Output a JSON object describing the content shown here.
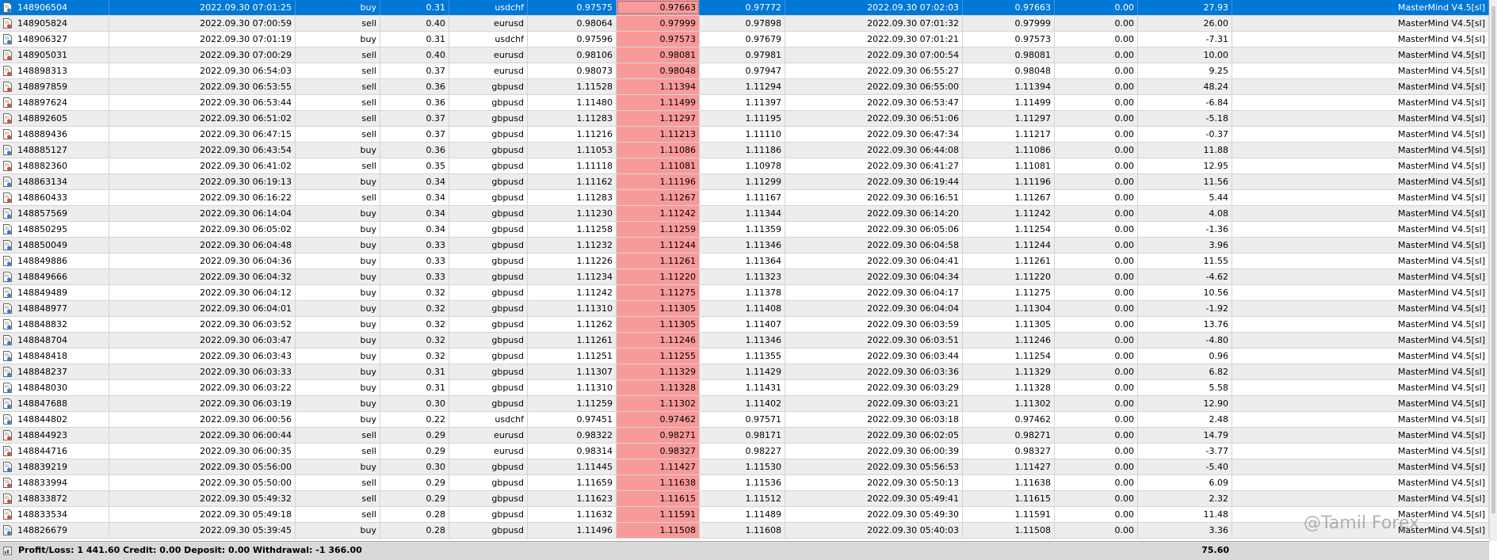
{
  "rows": [
    [
      "148906504",
      "2022.09.30 07:01:25",
      "buy",
      "0.31",
      "usdchf",
      "0.97575",
      "0.97663",
      "0.97772",
      "2022.09.30 07:02:03",
      "0.97663",
      "0.00",
      "27.93",
      "MasterMind V4.5[sl]"
    ],
    [
      "148905824",
      "2022.09.30 07:00:59",
      "sell",
      "0.40",
      "eurusd",
      "0.98064",
      "0.97999",
      "0.97898",
      "2022.09.30 07:01:32",
      "0.97999",
      "0.00",
      "26.00",
      "MasterMind V4.5[sl]"
    ],
    [
      "148906327",
      "2022.09.30 07:01:19",
      "buy",
      "0.31",
      "usdchf",
      "0.97596",
      "0.97573",
      "0.97679",
      "2022.09.30 07:01:21",
      "0.97573",
      "0.00",
      "-7.31",
      "MasterMind V4.5[sl]"
    ],
    [
      "148905031",
      "2022.09.30 07:00:29",
      "sell",
      "0.40",
      "eurusd",
      "0.98106",
      "0.98081",
      "0.97981",
      "2022.09.30 07:00:54",
      "0.98081",
      "0.00",
      "10.00",
      "MasterMind V4.5[sl]"
    ],
    [
      "148898313",
      "2022.09.30 06:54:03",
      "sell",
      "0.37",
      "eurusd",
      "0.98073",
      "0.98048",
      "0.97947",
      "2022.09.30 06:55:27",
      "0.98048",
      "0.00",
      "9.25",
      "MasterMind V4.5[sl]"
    ],
    [
      "148897859",
      "2022.09.30 06:53:55",
      "sell",
      "0.36",
      "gbpusd",
      "1.11528",
      "1.11394",
      "1.11294",
      "2022.09.30 06:55:00",
      "1.11394",
      "0.00",
      "48.24",
      "MasterMind V4.5[sl]"
    ],
    [
      "148897624",
      "2022.09.30 06:53:44",
      "sell",
      "0.36",
      "gbpusd",
      "1.11480",
      "1.11499",
      "1.11397",
      "2022.09.30 06:53:47",
      "1.11499",
      "0.00",
      "-6.84",
      "MasterMind V4.5[sl]"
    ],
    [
      "148892605",
      "2022.09.30 06:51:02",
      "sell",
      "0.37",
      "gbpusd",
      "1.11283",
      "1.11297",
      "1.11195",
      "2022.09.30 06:51:06",
      "1.11297",
      "0.00",
      "-5.18",
      "MasterMind V4.5[sl]"
    ],
    [
      "148889436",
      "2022.09.30 06:47:15",
      "sell",
      "0.37",
      "gbpusd",
      "1.11216",
      "1.11213",
      "1.11110",
      "2022.09.30 06:47:34",
      "1.11217",
      "0.00",
      "-0.37",
      "MasterMind V4.5[sl]"
    ],
    [
      "148885127",
      "2022.09.30 06:43:54",
      "buy",
      "0.36",
      "gbpusd",
      "1.11053",
      "1.11086",
      "1.11186",
      "2022.09.30 06:44:08",
      "1.11086",
      "0.00",
      "11.88",
      "MasterMind V4.5[sl]"
    ],
    [
      "148882360",
      "2022.09.30 06:41:02",
      "sell",
      "0.35",
      "gbpusd",
      "1.11118",
      "1.11081",
      "1.10978",
      "2022.09.30 06:41:27",
      "1.11081",
      "0.00",
      "12.95",
      "MasterMind V4.5[sl]"
    ],
    [
      "148863134",
      "2022.09.30 06:19:13",
      "buy",
      "0.34",
      "gbpusd",
      "1.11162",
      "1.11196",
      "1.11299",
      "2022.09.30 06:19:44",
      "1.11196",
      "0.00",
      "11.56",
      "MasterMind V4.5[sl]"
    ],
    [
      "148860433",
      "2022.09.30 06:16:22",
      "sell",
      "0.34",
      "gbpusd",
      "1.11283",
      "1.11267",
      "1.11167",
      "2022.09.30 06:16:51",
      "1.11267",
      "0.00",
      "5.44",
      "MasterMind V4.5[sl]"
    ],
    [
      "148857569",
      "2022.09.30 06:14:04",
      "buy",
      "0.34",
      "gbpusd",
      "1.11230",
      "1.11242",
      "1.11344",
      "2022.09.30 06:14:20",
      "1.11242",
      "0.00",
      "4.08",
      "MasterMind V4.5[sl]"
    ],
    [
      "148850295",
      "2022.09.30 06:05:02",
      "buy",
      "0.34",
      "gbpusd",
      "1.11258",
      "1.11259",
      "1.11359",
      "2022.09.30 06:05:06",
      "1.11254",
      "0.00",
      "-1.36",
      "MasterMind V4.5[sl]"
    ],
    [
      "148850049",
      "2022.09.30 06:04:48",
      "buy",
      "0.33",
      "gbpusd",
      "1.11232",
      "1.11244",
      "1.11346",
      "2022.09.30 06:04:58",
      "1.11244",
      "0.00",
      "3.96",
      "MasterMind V4.5[sl]"
    ],
    [
      "148849886",
      "2022.09.30 06:04:36",
      "buy",
      "0.33",
      "gbpusd",
      "1.11226",
      "1.11261",
      "1.11364",
      "2022.09.30 06:04:41",
      "1.11261",
      "0.00",
      "11.55",
      "MasterMind V4.5[sl]"
    ],
    [
      "148849666",
      "2022.09.30 06:04:32",
      "buy",
      "0.33",
      "gbpusd",
      "1.11234",
      "1.11220",
      "1.11323",
      "2022.09.30 06:04:34",
      "1.11220",
      "0.00",
      "-4.62",
      "MasterMind V4.5[sl]"
    ],
    [
      "148849489",
      "2022.09.30 06:04:12",
      "buy",
      "0.32",
      "gbpusd",
      "1.11242",
      "1.11275",
      "1.11378",
      "2022.09.30 06:04:17",
      "1.11275",
      "0.00",
      "10.56",
      "MasterMind V4.5[sl]"
    ],
    [
      "148848977",
      "2022.09.30 06:04:01",
      "buy",
      "0.32",
      "gbpusd",
      "1.11310",
      "1.11305",
      "1.11408",
      "2022.09.30 06:04:04",
      "1.11304",
      "0.00",
      "-1.92",
      "MasterMind V4.5[sl]"
    ],
    [
      "148848832",
      "2022.09.30 06:03:52",
      "buy",
      "0.32",
      "gbpusd",
      "1.11262",
      "1.11305",
      "1.11407",
      "2022.09.30 06:03:59",
      "1.11305",
      "0.00",
      "13.76",
      "MasterMind V4.5[sl]"
    ],
    [
      "148848704",
      "2022.09.30 06:03:47",
      "buy",
      "0.32",
      "gbpusd",
      "1.11261",
      "1.11246",
      "1.11346",
      "2022.09.30 06:03:51",
      "1.11246",
      "0.00",
      "-4.80",
      "MasterMind V4.5[sl]"
    ],
    [
      "148848418",
      "2022.09.30 06:03:43",
      "buy",
      "0.32",
      "gbpusd",
      "1.11251",
      "1.11255",
      "1.11355",
      "2022.09.30 06:03:44",
      "1.11254",
      "0.00",
      "0.96",
      "MasterMind V4.5[sl]"
    ],
    [
      "148848237",
      "2022.09.30 06:03:33",
      "buy",
      "0.31",
      "gbpusd",
      "1.11307",
      "1.11329",
      "1.11429",
      "2022.09.30 06:03:36",
      "1.11329",
      "0.00",
      "6.82",
      "MasterMind V4.5[sl]"
    ],
    [
      "148848030",
      "2022.09.30 06:03:22",
      "buy",
      "0.31",
      "gbpusd",
      "1.11310",
      "1.11328",
      "1.11431",
      "2022.09.30 06:03:29",
      "1.11328",
      "0.00",
      "5.58",
      "MasterMind V4.5[sl]"
    ],
    [
      "148847688",
      "2022.09.30 06:03:19",
      "buy",
      "0.30",
      "gbpusd",
      "1.11259",
      "1.11302",
      "1.11402",
      "2022.09.30 06:03:21",
      "1.11302",
      "0.00",
      "12.90",
      "MasterMind V4.5[sl]"
    ],
    [
      "148844802",
      "2022.09.30 06:00:56",
      "buy",
      "0.22",
      "usdchf",
      "0.97451",
      "0.97462",
      "0.97571",
      "2022.09.30 06:03:18",
      "0.97462",
      "0.00",
      "2.48",
      "MasterMind V4.5[sl]"
    ],
    [
      "148844923",
      "2022.09.30 06:00:44",
      "sell",
      "0.29",
      "eurusd",
      "0.98322",
      "0.98271",
      "0.98171",
      "2022.09.30 06:02:05",
      "0.98271",
      "0.00",
      "14.79",
      "MasterMind V4.5[sl]"
    ],
    [
      "148844716",
      "2022.09.30 06:00:35",
      "sell",
      "0.29",
      "eurusd",
      "0.98314",
      "0.98327",
      "0.98227",
      "2022.09.30 06:00:39",
      "0.98327",
      "0.00",
      "-3.77",
      "MasterMind V4.5[sl]"
    ],
    [
      "148839219",
      "2022.09.30 05:56:00",
      "buy",
      "0.30",
      "gbpusd",
      "1.11445",
      "1.11427",
      "1.11530",
      "2022.09.30 05:56:53",
      "1.11427",
      "0.00",
      "-5.40",
      "MasterMind V4.5[sl]"
    ],
    [
      "148833994",
      "2022.09.30 05:50:00",
      "sell",
      "0.29",
      "gbpusd",
      "1.11659",
      "1.11638",
      "1.11536",
      "2022.09.30 05:50:13",
      "1.11638",
      "0.00",
      "6.09",
      "MasterMind V4.5[sl]"
    ],
    [
      "148833872",
      "2022.09.30 05:49:32",
      "sell",
      "0.29",
      "gbpusd",
      "1.11623",
      "1.11615",
      "1.11512",
      "2022.09.30 05:49:41",
      "1.11615",
      "0.00",
      "2.32",
      "MasterMind V4.5[sl]"
    ],
    [
      "148833534",
      "2022.09.30 05:49:18",
      "sell",
      "0.28",
      "gbpusd",
      "1.11632",
      "1.11591",
      "1.11489",
      "2022.09.30 05:49:30",
      "1.11591",
      "0.00",
      "11.48",
      "MasterMind V4.5[sl]"
    ],
    [
      "148826679",
      "2022.09.30 05:39:45",
      "buy",
      "0.28",
      "gbpusd",
      "1.11496",
      "1.11508",
      "1.11608",
      "2022.09.30 05:40:03",
      "1.11508",
      "0.00",
      "3.36",
      "MasterMind V4.5[sl]"
    ]
  ],
  "footer": {
    "summary": "Profit/Loss: 1 441.60  Credit: 0.00  Deposit: 0.00  Withdrawal: -1 366.00",
    "total": "75.60"
  },
  "watermark": "@Tamil Forex",
  "colors": {
    "selected_row": "#0078d7",
    "sl_highlight": "#f99a9a",
    "sell_icon_dot": "#e0452b",
    "buy_icon_dot": "#2f7bd8"
  },
  "icons": {
    "buy": "buy-order-icon",
    "sell": "sell-order-icon"
  }
}
